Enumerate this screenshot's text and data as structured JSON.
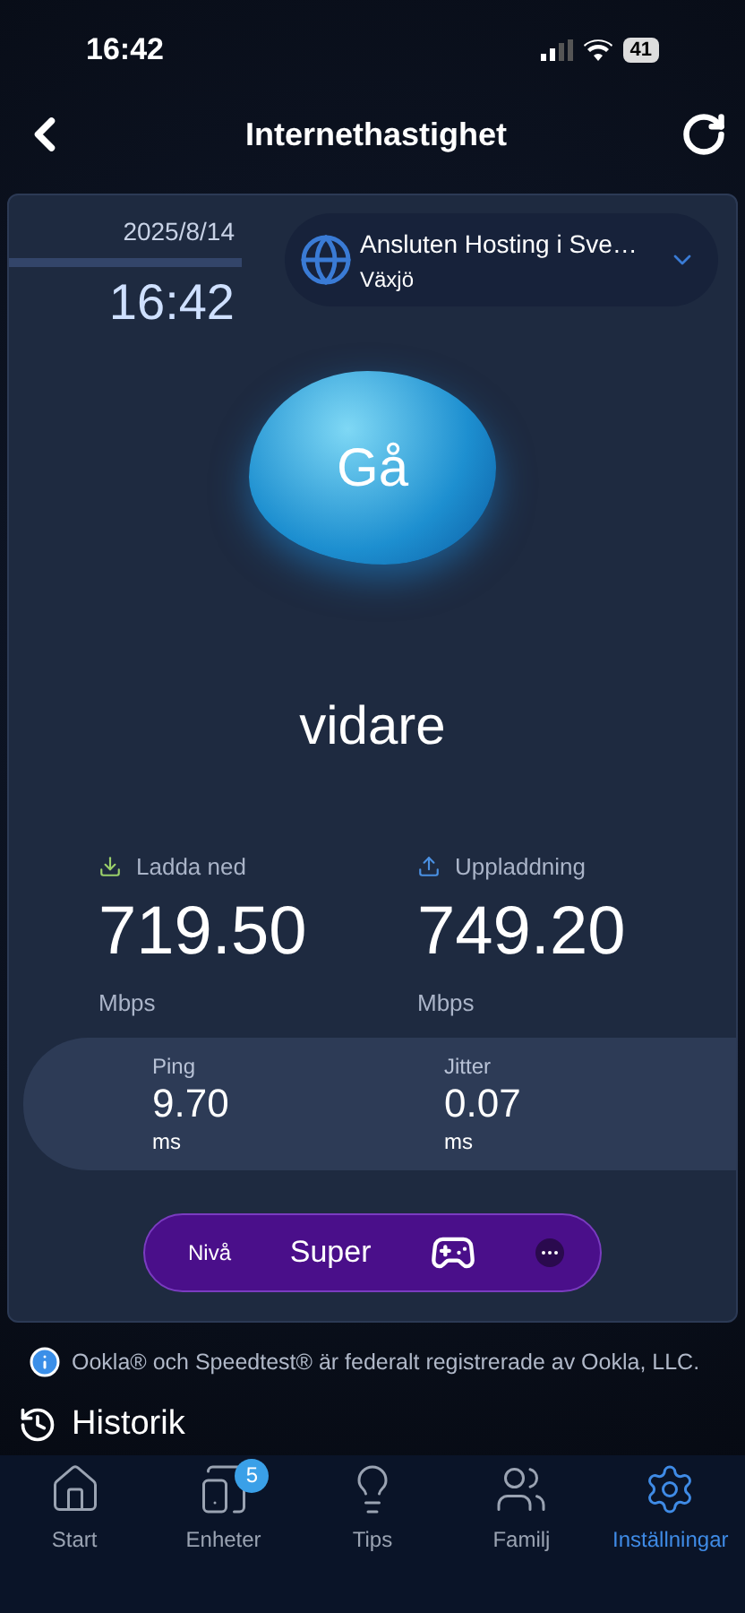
{
  "status_bar": {
    "time": "16:42",
    "battery": "41"
  },
  "header": {
    "title": "Internethastighet"
  },
  "card": {
    "date": "2025/8/14",
    "time": "16:42",
    "server": {
      "name": "Ansluten Hosting i Sve…",
      "location": "Växjö"
    },
    "go_button": "Gå",
    "status": "vidare",
    "results": [
      {
        "kind": "download",
        "label": "Ladda ned",
        "value": "719.50",
        "unit": "Mbps"
      },
      {
        "kind": "upload",
        "label": "Uppladdning",
        "value": "749.20",
        "unit": "Mbps"
      }
    ],
    "latency": [
      {
        "label": "Ping",
        "value": "9.70",
        "unit": "ms"
      },
      {
        "label": "Jitter",
        "value": "0.07",
        "unit": "ms"
      }
    ],
    "level": {
      "label": "Nivå",
      "value": "Super"
    }
  },
  "disclaimer": "Ookla® och Speedtest® är federalt registrerade av Ookla, LLC.",
  "history": "Historik",
  "tabs": [
    {
      "kind": "home",
      "label": "Start",
      "selected": false
    },
    {
      "kind": "devices",
      "label": "Enheter",
      "selected": false,
      "badge": "5"
    },
    {
      "kind": "tips",
      "label": "Tips",
      "selected": false
    },
    {
      "kind": "family",
      "label": "Familj",
      "selected": false
    },
    {
      "kind": "settings",
      "label": "Inställningar",
      "selected": true
    }
  ]
}
